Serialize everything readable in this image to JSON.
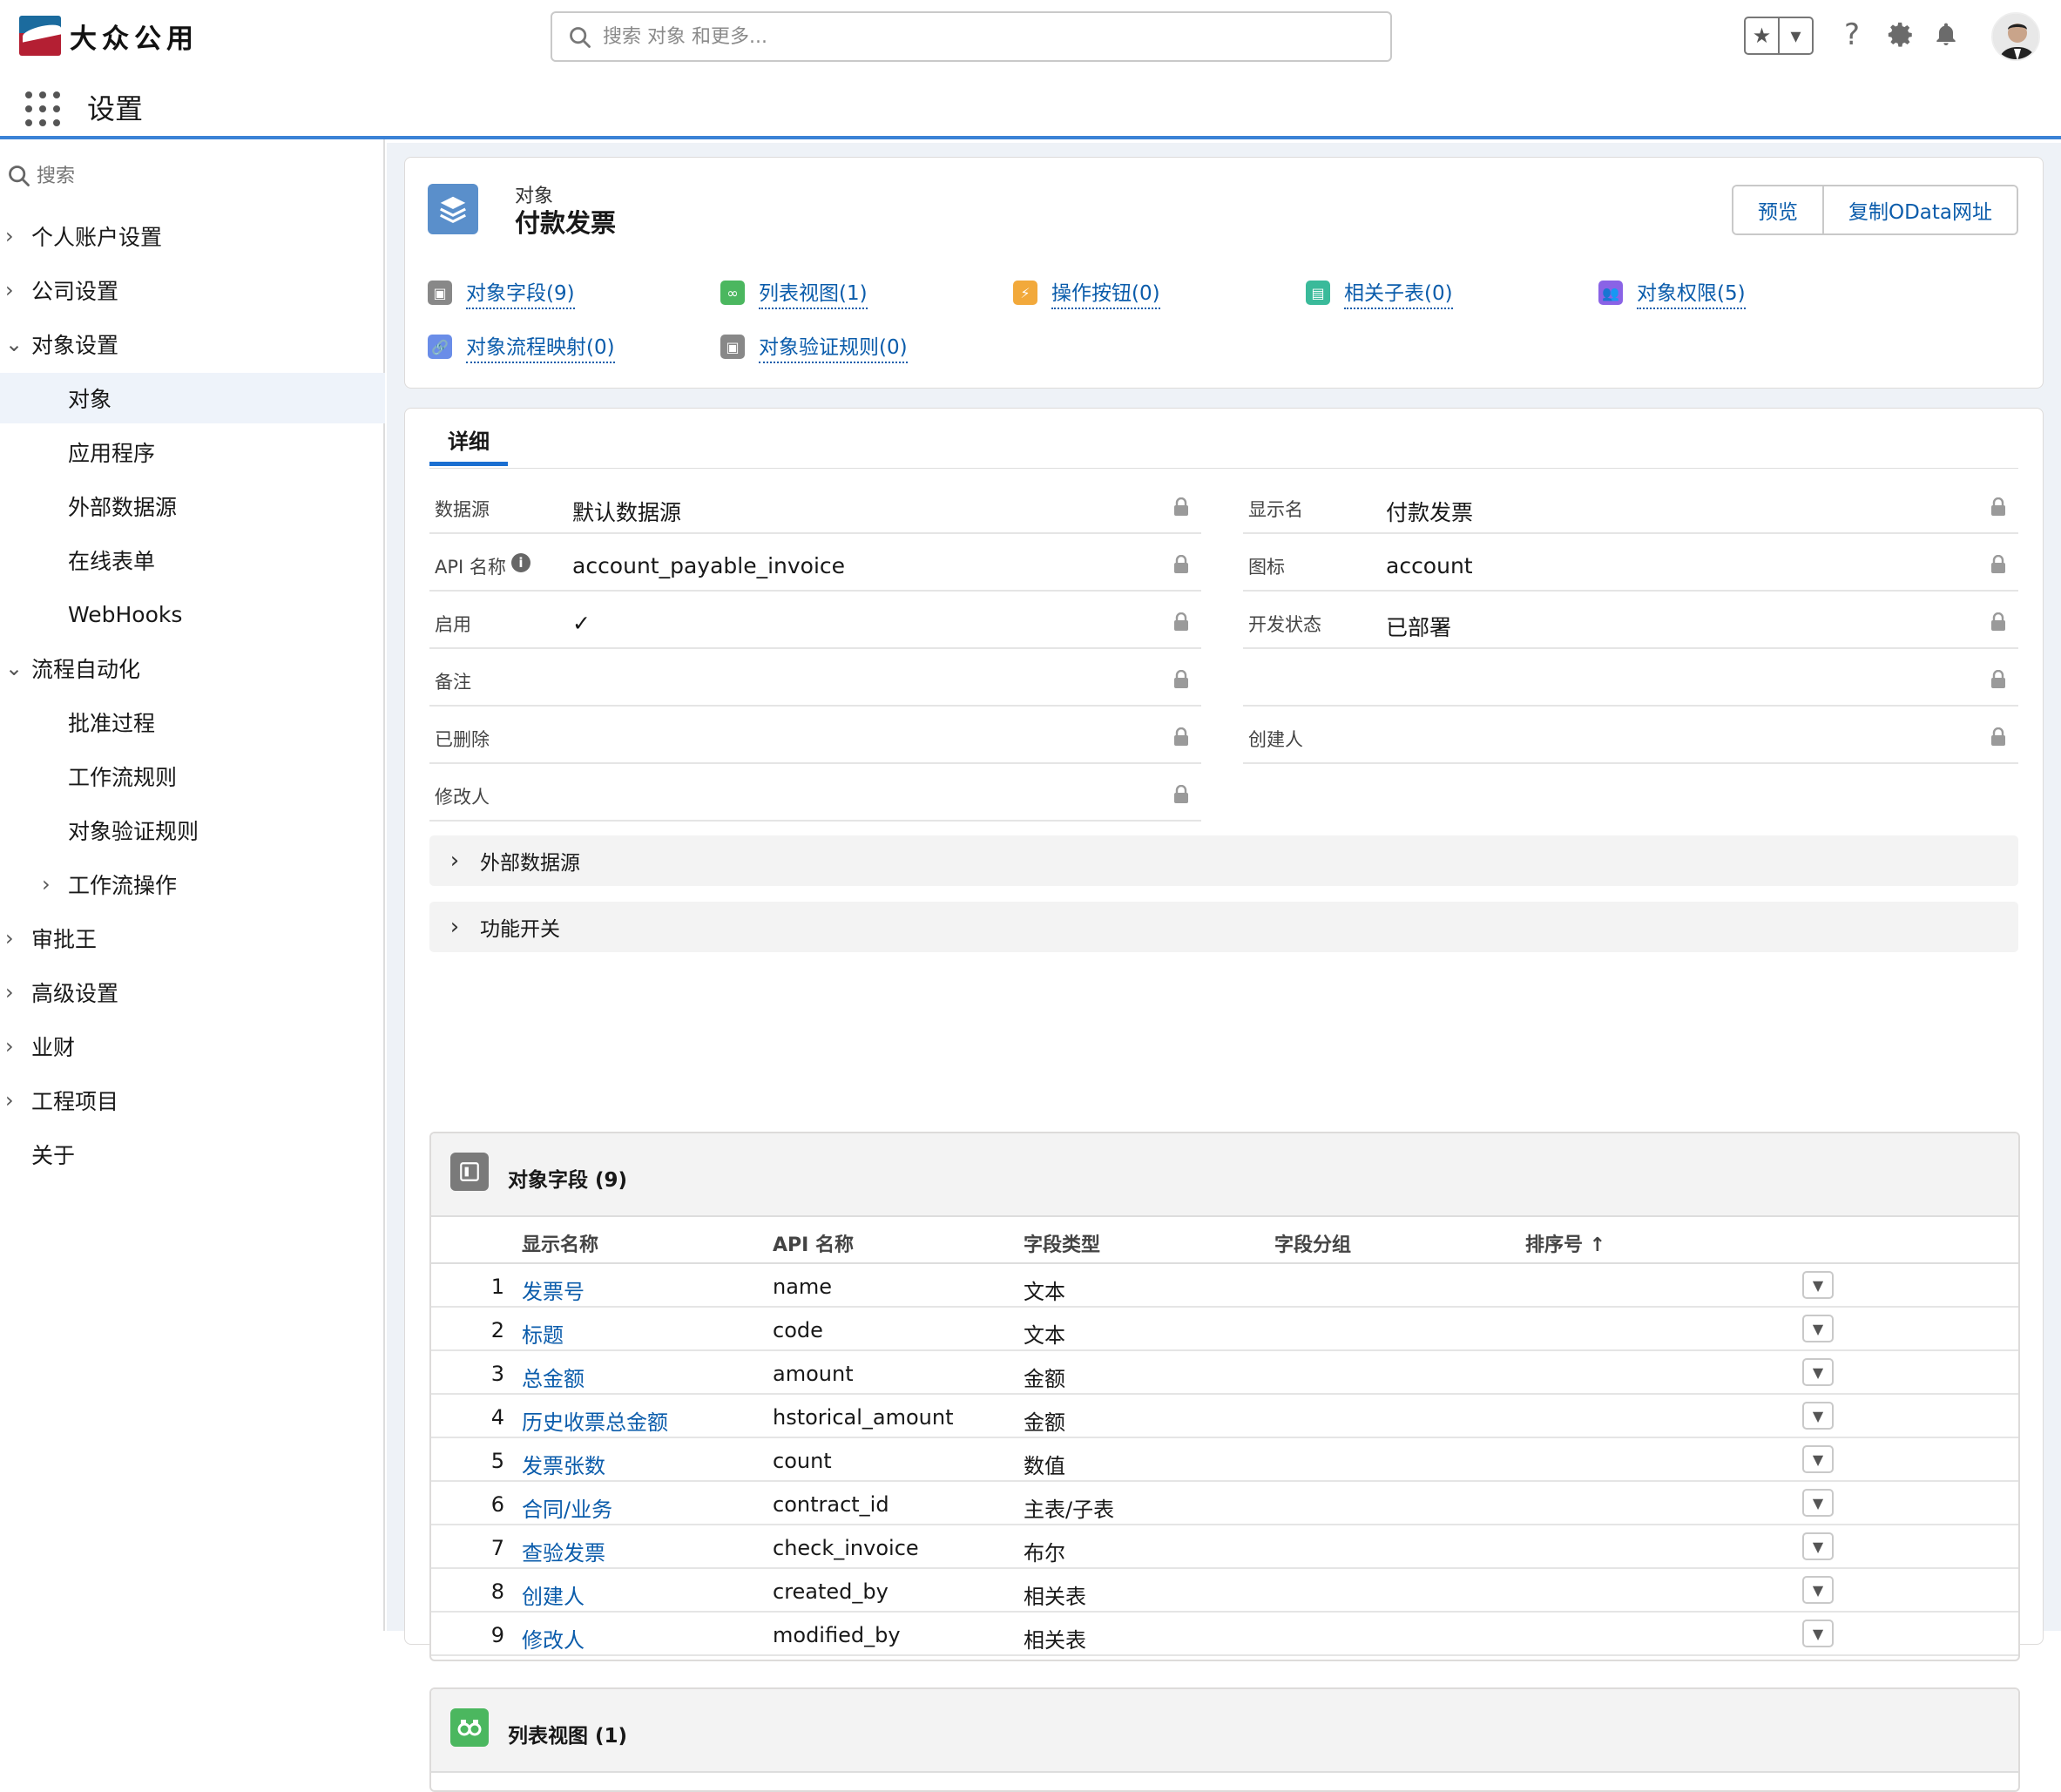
{
  "header": {
    "brand": "大众公用",
    "search_placeholder": "搜索 对象 和更多...",
    "app_title": "设置"
  },
  "sidebar": {
    "search_placeholder": "搜索",
    "items": [
      {
        "label": "个人账户设置",
        "level": 0,
        "expanded": false
      },
      {
        "label": "公司设置",
        "level": 0,
        "expanded": false
      },
      {
        "label": "对象设置",
        "level": 0,
        "expanded": true
      },
      {
        "label": "对象",
        "level": 1,
        "active": true
      },
      {
        "label": "应用程序",
        "level": 1
      },
      {
        "label": "外部数据源",
        "level": 1
      },
      {
        "label": "在线表单",
        "level": 1
      },
      {
        "label": "WebHooks",
        "level": 1
      },
      {
        "label": "流程自动化",
        "level": 0,
        "expanded": true
      },
      {
        "label": "批准过程",
        "level": 1
      },
      {
        "label": "工作流规则",
        "level": 1
      },
      {
        "label": "对象验证规则",
        "level": 1
      },
      {
        "label": "工作流操作",
        "level": 1,
        "expanded": false
      },
      {
        "label": "审批王",
        "level": 0,
        "expanded": false
      },
      {
        "label": "高级设置",
        "level": 0,
        "expanded": false
      },
      {
        "label": "业财",
        "level": 0,
        "expanded": false
      },
      {
        "label": "工程项目",
        "level": 0,
        "expanded": false
      },
      {
        "label": "关于",
        "level": 0
      }
    ]
  },
  "object": {
    "label": "对象",
    "name": "付款发票",
    "buttons": {
      "preview": "预览",
      "copy_odata": "复制OData网址"
    },
    "quick_links": [
      {
        "label": "对象字段(9)",
        "color": "#888888"
      },
      {
        "label": "列表视图(1)",
        "color": "#4bb75f"
      },
      {
        "label": "操作按钮(0)",
        "color": "#f2a93b"
      },
      {
        "label": "相关子表(0)",
        "color": "#3aba9a"
      },
      {
        "label": "对象权限(5)",
        "color": "#8a63e6"
      },
      {
        "label": "对象流程映射(0)",
        "color": "#6a8de8"
      },
      {
        "label": "对象验证规则(0)",
        "color": "#888888"
      }
    ]
  },
  "detail": {
    "tab": "详细",
    "fields_left": [
      {
        "label": "数据源",
        "value": "默认数据源"
      },
      {
        "label": "API 名称",
        "value": "account_payable_invoice"
      },
      {
        "label": "启用",
        "value": "✓"
      },
      {
        "label": "备注",
        "value": ""
      },
      {
        "label": "已删除",
        "value": ""
      },
      {
        "label": "修改人",
        "value": ""
      }
    ],
    "fields_right": [
      {
        "label": "显示名",
        "value": "付款发票"
      },
      {
        "label": "图标",
        "value": "account"
      },
      {
        "label": "开发状态",
        "value": "已部署"
      },
      {
        "label": "",
        "value": ""
      },
      {
        "label": "创建人",
        "value": ""
      }
    ],
    "sections": [
      "外部数据源",
      "功能开关"
    ]
  },
  "fields_list": {
    "title": "对象字段 (9)",
    "columns": [
      "显示名称",
      "API 名称",
      "字段类型",
      "字段分组",
      "排序号 ↑"
    ],
    "rows": [
      {
        "n": "1",
        "name": "发票号",
        "api": "name",
        "type": "文本"
      },
      {
        "n": "2",
        "name": "标题",
        "api": "code",
        "type": "文本"
      },
      {
        "n": "3",
        "name": "总金额",
        "api": "amount",
        "type": "金额"
      },
      {
        "n": "4",
        "name": "历史收票总金额",
        "api": "hstorical_amount",
        "type": "金额"
      },
      {
        "n": "5",
        "name": "发票张数",
        "api": "count",
        "type": "数值"
      },
      {
        "n": "6",
        "name": "合同/业务",
        "api": "contract_id",
        "type": "主表/子表"
      },
      {
        "n": "7",
        "name": "查验发票",
        "api": "check_invoice",
        "type": "布尔"
      },
      {
        "n": "8",
        "name": "创建人",
        "api": "created_by",
        "type": "相关表"
      },
      {
        "n": "9",
        "name": "修改人",
        "api": "modified_by",
        "type": "相关表"
      }
    ]
  },
  "list_views": {
    "title": "列表视图 (1)"
  }
}
